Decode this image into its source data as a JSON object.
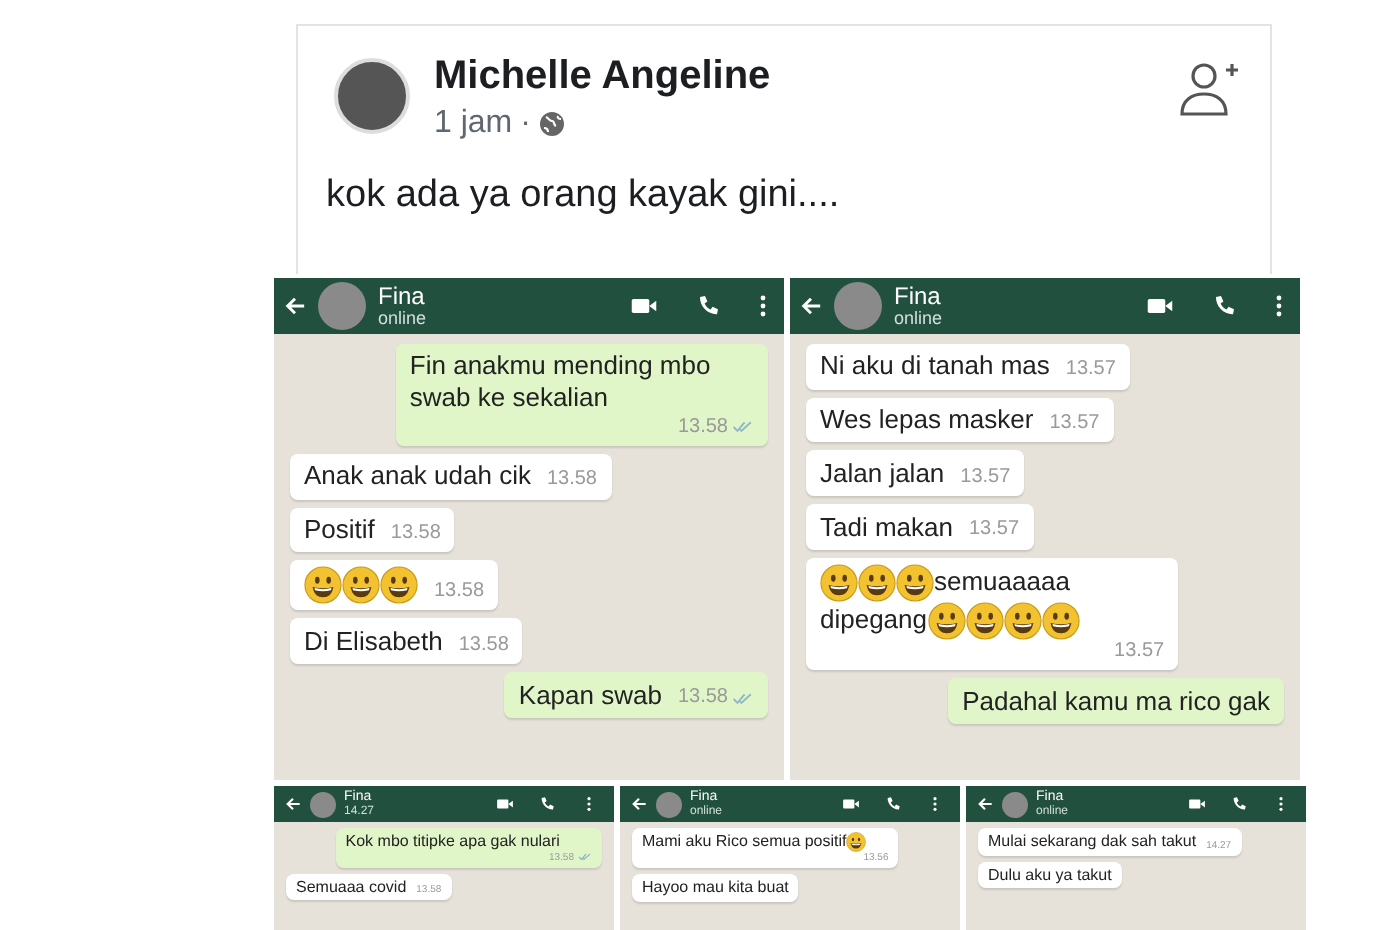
{
  "post": {
    "author": "Michelle Angeline",
    "time": "1 jam",
    "separator": "·",
    "text": "kok ada ya orang kayak gini...."
  },
  "top_chats": [
    {
      "contact": "Fina",
      "status": "online",
      "messages": [
        {
          "kind": "out",
          "parts": [
            {
              "kind": "text",
              "text": "Fin anakmu mending mbo swab ke sekalian"
            }
          ],
          "time": "13.58"
        },
        {
          "kind": "in",
          "parts": [
            {
              "kind": "text",
              "text": "Anak anak udah cik"
            }
          ],
          "time": "13.58"
        },
        {
          "kind": "in",
          "parts": [
            {
              "kind": "text",
              "text": "Positif"
            }
          ],
          "time": "13.58"
        },
        {
          "kind": "in",
          "parts": [
            {
              "kind": "emoji"
            },
            {
              "kind": "emoji"
            },
            {
              "kind": "emoji"
            }
          ],
          "time": "13.58"
        },
        {
          "kind": "in",
          "parts": [
            {
              "kind": "text",
              "text": "Di Elisabeth"
            }
          ],
          "time": "13.58"
        },
        {
          "kind": "out",
          "parts": [
            {
              "kind": "text",
              "text": "Kapan swab"
            }
          ],
          "time": "13.58"
        }
      ]
    },
    {
      "contact": "Fina",
      "status": "online",
      "messages": [
        {
          "kind": "in",
          "parts": [
            {
              "kind": "text",
              "text": "Ni aku di tanah mas"
            }
          ],
          "time": "13.57"
        },
        {
          "kind": "in",
          "parts": [
            {
              "kind": "text",
              "text": "Wes lepas masker"
            }
          ],
          "time": "13.57"
        },
        {
          "kind": "in",
          "parts": [
            {
              "kind": "text",
              "text": "Jalan jalan"
            }
          ],
          "time": "13.57"
        },
        {
          "kind": "in",
          "parts": [
            {
              "kind": "text",
              "text": "Tadi makan"
            }
          ],
          "time": "13.57"
        },
        {
          "kind": "in",
          "parts": [
            {
              "kind": "emoji"
            },
            {
              "kind": "emoji"
            },
            {
              "kind": "emoji"
            },
            {
              "kind": "text",
              "text": "semuaaaaa"
            },
            {
              "kind": "text",
              "text": "dipegang"
            },
            {
              "kind": "emoji"
            },
            {
              "kind": "emoji"
            },
            {
              "kind": "emoji"
            },
            {
              "kind": "emoji"
            }
          ],
          "time": "13.57"
        },
        {
          "kind": "out",
          "parts": [
            {
              "kind": "text",
              "text": "Padahal kamu ma rico gak"
            }
          ]
        }
      ]
    }
  ],
  "bottom_chats": [
    {
      "contact": "Fina",
      "status": "14.27",
      "messages": [
        {
          "kind": "out",
          "parts": [
            {
              "kind": "text",
              "text": "Kok mbo titipke apa gak nulari"
            }
          ],
          "time": "13.58"
        },
        {
          "kind": "in",
          "parts": [
            {
              "kind": "text",
              "text": "Semuaaa covid"
            }
          ],
          "time": "13.58"
        }
      ]
    },
    {
      "contact": "Fina",
      "status": "online",
      "messages": [
        {
          "kind": "in",
          "parts": [
            {
              "kind": "text",
              "text": "Mami aku Rico semua positif"
            },
            {
              "kind": "emoji"
            }
          ],
          "time": "13.56"
        },
        {
          "kind": "in",
          "parts": [
            {
              "kind": "text",
              "text": "Hayoo mau kita buat"
            }
          ]
        }
      ]
    },
    {
      "contact": "Fina",
      "status": "online",
      "messages": [
        {
          "kind": "in",
          "parts": [
            {
              "kind": "text",
              "text": "Mulai sekarang dak sah takut"
            }
          ],
          "time": "14.27"
        },
        {
          "kind": "in",
          "parts": [
            {
              "kind": "text",
              "text": "Dulu aku ya takut"
            }
          ]
        }
      ]
    }
  ]
}
